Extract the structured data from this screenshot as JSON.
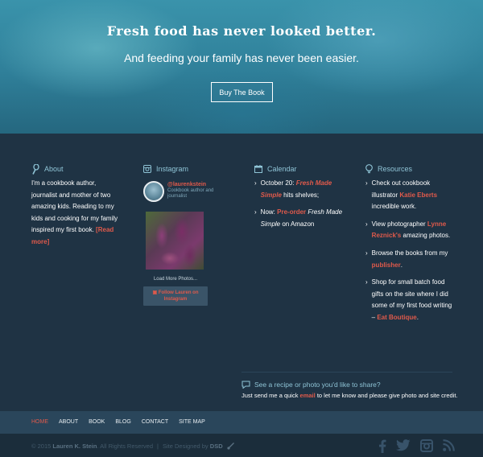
{
  "hero": {
    "title": "Fresh food has never looked better.",
    "subtitle": "And feeding your family has never been easier.",
    "button": "Buy The Book"
  },
  "about": {
    "heading": "About",
    "text": "I'm a cookbook author, journalist and mother of two amazing kids. Reading to my kids and cooking for my family inspired my first book.",
    "read_more": "[Read more]"
  },
  "instagram": {
    "heading": "Instagram",
    "handle": "@laurenkstein",
    "bio": "Cookbook author and journalist",
    "load_more": "Load More Photos...",
    "follow": "Follow Lauren on Instagram"
  },
  "calendar": {
    "heading": "Calendar",
    "items": [
      {
        "prefix": "October 20: ",
        "link": "Fresh Made Simple",
        "suffix": " hits shelves;"
      },
      {
        "prefix": "Now: ",
        "link": "Pre-order",
        "title": " Fresh Made Simple",
        "suffix": " on Amazon"
      }
    ]
  },
  "resources": {
    "heading": "Resources",
    "items": [
      {
        "a": "Check out cookbook illustrator ",
        "link": "Katie Eberts",
        "b": " incredible work."
      },
      {
        "a": "View photographer ",
        "link": "Lynne Reznick's",
        "b": " amazing photos."
      },
      {
        "a": "Browse the books from my ",
        "link": "publisher",
        "b": "."
      },
      {
        "a": "Shop for small batch food gifts on the site where I did some of my first food writing – ",
        "link": "Eat Boutique",
        "b": "."
      }
    ]
  },
  "share": {
    "heading": "See a recipe or photo you'd like to share?",
    "a": "Just send me a quick ",
    "link": "email",
    "b": " to let me know and please give photo and site credit."
  },
  "nav": [
    "HOME",
    "ABOUT",
    "BOOK",
    "BLOG",
    "CONTACT",
    "SITE MAP"
  ],
  "footer": {
    "copyright_a": "© 2015 ",
    "owner": "Lauren K. Stein",
    "copyright_b": ". All Rights Reserved",
    "sep": "|",
    "designed_a": "Site Designed by ",
    "designer": "DSD"
  },
  "colors": {
    "accent": "#e05a4b",
    "heading": "#8fc4d6",
    "background": "#1f3344"
  },
  "icons": [
    "whisk-icon",
    "instagram-icon",
    "calendar-icon",
    "lightbulb-icon",
    "chat-icon",
    "facebook-icon",
    "twitter-icon",
    "instagram-icon",
    "rss-icon"
  ]
}
